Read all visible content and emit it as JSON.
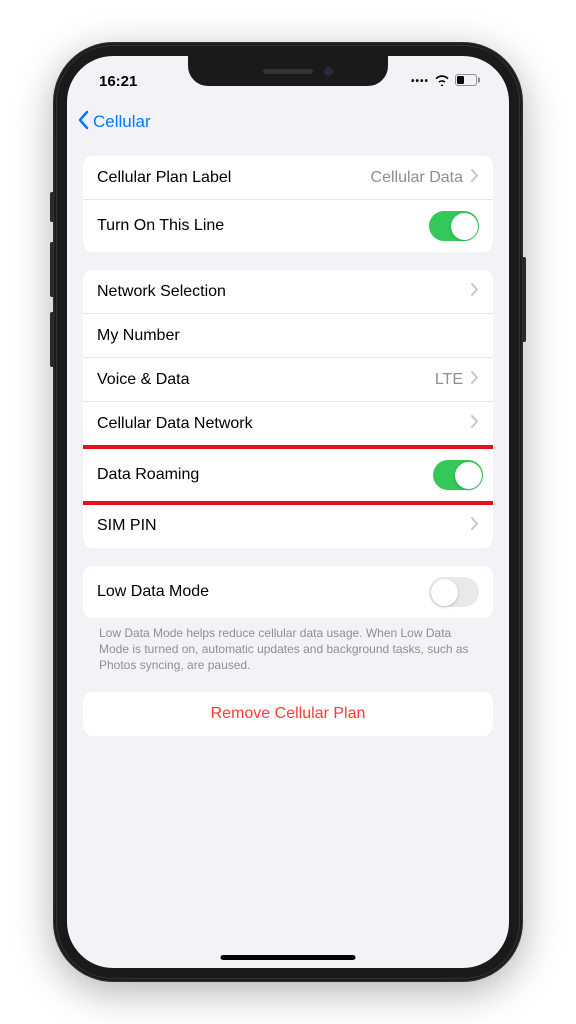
{
  "status": {
    "time": "16:21"
  },
  "nav": {
    "back_label": "Cellular"
  },
  "section1": {
    "plan_label": {
      "label": "Cellular Plan Label",
      "value": "Cellular Data"
    },
    "turn_on": {
      "label": "Turn On This Line",
      "toggle": true
    }
  },
  "section2": {
    "network_selection": {
      "label": "Network Selection"
    },
    "my_number": {
      "label": "My Number"
    },
    "voice_data": {
      "label": "Voice & Data",
      "value": "LTE"
    },
    "cellular_data_network": {
      "label": "Cellular Data Network"
    },
    "data_roaming": {
      "label": "Data Roaming",
      "toggle": true
    },
    "sim_pin": {
      "label": "SIM PIN"
    }
  },
  "section3": {
    "low_data_mode": {
      "label": "Low Data Mode",
      "toggle": false
    },
    "footer": "Low Data Mode helps reduce cellular data usage. When Low Data Mode is turned on, automatic updates and background tasks, such as Photos syncing, are paused."
  },
  "section4": {
    "remove": {
      "label": "Remove Cellular Plan"
    }
  },
  "colors": {
    "accent": "#007aff",
    "toggle_on": "#34c759",
    "destructive": "#ff3b30",
    "highlight": "#e6111e"
  }
}
